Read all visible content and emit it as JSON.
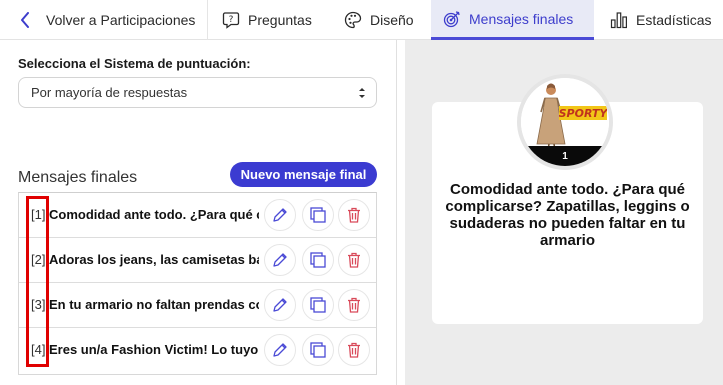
{
  "nav": {
    "back_label": "Volver a Participaciones",
    "preguntas_label": "Preguntas",
    "diseno_label": "Diseño",
    "mensajes_label": "Mensajes finales",
    "estadisticas_label": "Estadísticas"
  },
  "scoring": {
    "label": "Selecciona el Sistema de puntuación:",
    "selected": "Por mayoría de respuestas"
  },
  "messages": {
    "title": "Mensajes finales",
    "new_button": "Nuevo mensaje final",
    "items": [
      {
        "index": "[1]",
        "text": "Comodidad ante todo. ¿Para qué complicarse?"
      },
      {
        "index": "[2]",
        "text": "Adoras los jeans, las camisetas básicas"
      },
      {
        "index": "[3]",
        "text": "En tu armario no faltan prendas con"
      },
      {
        "index": "[4]",
        "text": "Eres un/a Fashion Victim! Lo tuyo es"
      }
    ]
  },
  "preview": {
    "badge_number": "1",
    "logo_text": "SPORTY",
    "message": "Comodidad ante todo. ¿Para qué complicarse? Zapatillas, leggins o sudaderas no pueden faltar en tu armario"
  },
  "colors": {
    "accent": "#3b3bd1",
    "active_tab_bg": "#e8eaf6",
    "annotation": "#e00000",
    "delete": "#d94a5a"
  }
}
